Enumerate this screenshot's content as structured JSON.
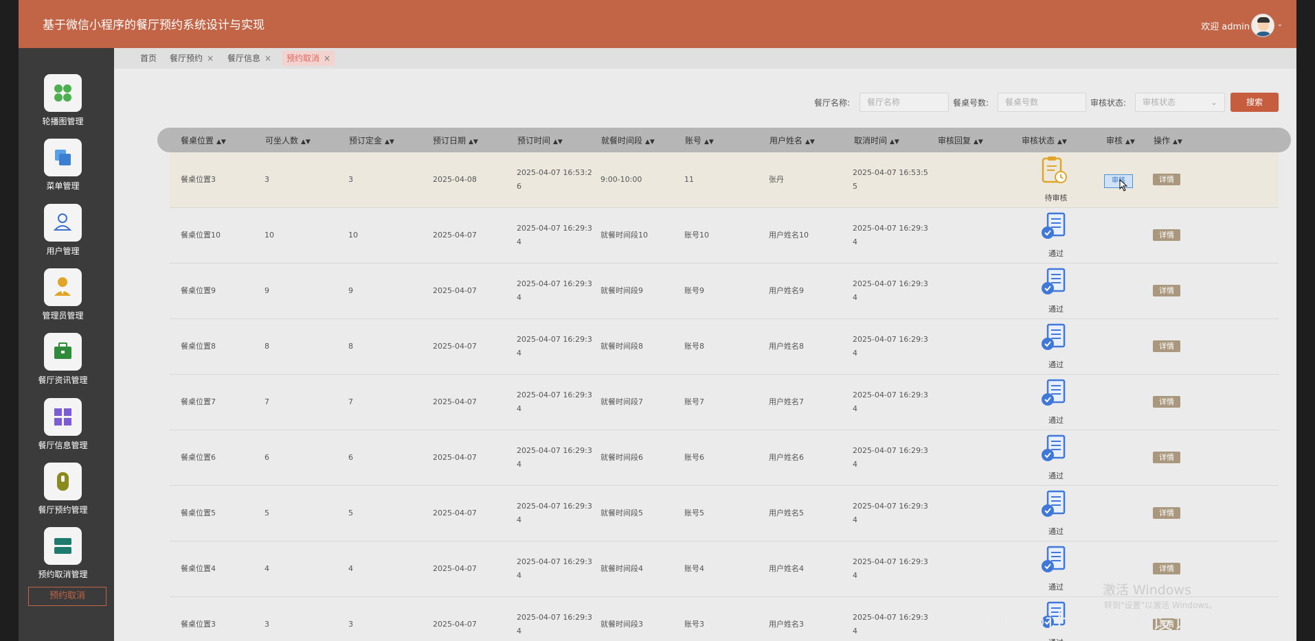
{
  "app": {
    "title": "基于微信小程序的餐厅预约系统设计与实现",
    "welcome": "欢迎 admin"
  },
  "sidebar": {
    "items": [
      {
        "label": "轮播图管理",
        "icon": "dots-grid-icon"
      },
      {
        "label": "菜单管理",
        "icon": "stack-cards-icon"
      },
      {
        "label": "用户管理",
        "icon": "user-outline-icon"
      },
      {
        "label": "管理员管理",
        "icon": "admin-person-icon"
      },
      {
        "label": "餐厅资讯管理",
        "icon": "briefcase-icon"
      },
      {
        "label": "餐厅信息管理",
        "icon": "tiles-icon"
      },
      {
        "label": "餐厅预约管理",
        "icon": "phone-pill-icon"
      },
      {
        "label": "预约取消管理",
        "icon": "server-stack-icon"
      }
    ],
    "active_sub": "预约取消"
  },
  "tabs": [
    {
      "label": "首页",
      "closable": false
    },
    {
      "label": "餐厅预约",
      "closable": true
    },
    {
      "label": "餐厅信息",
      "closable": true
    },
    {
      "label": "预约取消",
      "closable": true,
      "active": true
    }
  ],
  "close_glyph": "×",
  "search": {
    "name_label": "餐厅名称:",
    "name_placeholder": "餐厅名称",
    "table_label": "餐桌号数:",
    "table_placeholder": "餐桌号数",
    "status_label": "审核状态:",
    "status_placeholder": "审核状态",
    "button": "搜索"
  },
  "columns": [
    "餐桌位置",
    "可坐人数",
    "预订定金",
    "预订日期",
    "预订时间",
    "就餐时间段",
    "账号",
    "用户姓名",
    "取消时间",
    "审核回复",
    "审核状态",
    "审核",
    "操作"
  ],
  "sort_glyph": "▲▼",
  "rows": [
    {
      "location": "餐桌位置3",
      "seats": "3",
      "deposit": "3",
      "date": "2025-04-08",
      "time1": "2025-04-07 16:53:2",
      "time2": "6",
      "period": "9:00-10:00",
      "account": "11",
      "username": "张丹",
      "cancel1": "2025-04-07 16:53:5",
      "cancel2": "5",
      "reply": "",
      "status": "待审核",
      "audit": "审核",
      "detail": "详情",
      "pending": true
    },
    {
      "location": "餐桌位置10",
      "seats": "10",
      "deposit": "10",
      "date": "2025-04-07",
      "time1": "2025-04-07 16:29:3",
      "time2": "4",
      "period": "就餐时间段10",
      "account": "账号10",
      "username": "用户姓名10",
      "cancel1": "2025-04-07 16:29:3",
      "cancel2": "4",
      "reply": "",
      "status": "通过",
      "audit": "",
      "detail": "详情",
      "pending": false
    },
    {
      "location": "餐桌位置9",
      "seats": "9",
      "deposit": "9",
      "date": "2025-04-07",
      "time1": "2025-04-07 16:29:3",
      "time2": "4",
      "period": "就餐时间段9",
      "account": "账号9",
      "username": "用户姓名9",
      "cancel1": "2025-04-07 16:29:3",
      "cancel2": "4",
      "reply": "",
      "status": "通过",
      "audit": "",
      "detail": "详情",
      "pending": false
    },
    {
      "location": "餐桌位置8",
      "seats": "8",
      "deposit": "8",
      "date": "2025-04-07",
      "time1": "2025-04-07 16:29:3",
      "time2": "4",
      "period": "就餐时间段8",
      "account": "账号8",
      "username": "用户姓名8",
      "cancel1": "2025-04-07 16:29:3",
      "cancel2": "4",
      "reply": "",
      "status": "通过",
      "audit": "",
      "detail": "详情",
      "pending": false
    },
    {
      "location": "餐桌位置7",
      "seats": "7",
      "deposit": "7",
      "date": "2025-04-07",
      "time1": "2025-04-07 16:29:3",
      "time2": "4",
      "period": "就餐时间段7",
      "account": "账号7",
      "username": "用户姓名7",
      "cancel1": "2025-04-07 16:29:3",
      "cancel2": "4",
      "reply": "",
      "status": "通过",
      "audit": "",
      "detail": "详情",
      "pending": false
    },
    {
      "location": "餐桌位置6",
      "seats": "6",
      "deposit": "6",
      "date": "2025-04-07",
      "time1": "2025-04-07 16:29:3",
      "time2": "4",
      "period": "就餐时间段6",
      "account": "账号6",
      "username": "用户姓名6",
      "cancel1": "2025-04-07 16:29:3",
      "cancel2": "4",
      "reply": "",
      "status": "通过",
      "audit": "",
      "detail": "详情",
      "pending": false
    },
    {
      "location": "餐桌位置5",
      "seats": "5",
      "deposit": "5",
      "date": "2025-04-07",
      "time1": "2025-04-07 16:29:3",
      "time2": "4",
      "period": "就餐时间段5",
      "account": "账号5",
      "username": "用户姓名5",
      "cancel1": "2025-04-07 16:29:3",
      "cancel2": "4",
      "reply": "",
      "status": "通过",
      "audit": "",
      "detail": "详情",
      "pending": false
    },
    {
      "location": "餐桌位置4",
      "seats": "4",
      "deposit": "4",
      "date": "2025-04-07",
      "time1": "2025-04-07 16:29:3",
      "time2": "4",
      "period": "就餐时间段4",
      "account": "账号4",
      "username": "用户姓名4",
      "cancel1": "2025-04-07 16:29:3",
      "cancel2": "4",
      "reply": "",
      "status": "通过",
      "audit": "",
      "detail": "详情",
      "pending": false
    },
    {
      "location": "餐桌位置3",
      "seats": "3",
      "deposit": "3",
      "date": "2025-04-07",
      "time1": "2025-04-07 16:29:3",
      "time2": "4",
      "period": "就餐时间段3",
      "account": "账号3",
      "username": "用户姓名3",
      "cancel1": "2025-04-07 16:29:3",
      "cancel2": "4",
      "reply": "",
      "status": "通过",
      "audit": "",
      "detail": "详情",
      "pending": false
    }
  ],
  "watermarks": {
    "activate_title": "激活 Windows",
    "activate_sub": "转到\"设置\"以激活 Windows。",
    "csdn": "CSDN @计算机毕业设计小明哥"
  },
  "colors": {
    "topbar": "#c26446",
    "sidebar": "#3b3b3b",
    "accent": "#c75d3f",
    "pending_icon": "#e0a526",
    "approved_icon": "#3f78d8"
  }
}
